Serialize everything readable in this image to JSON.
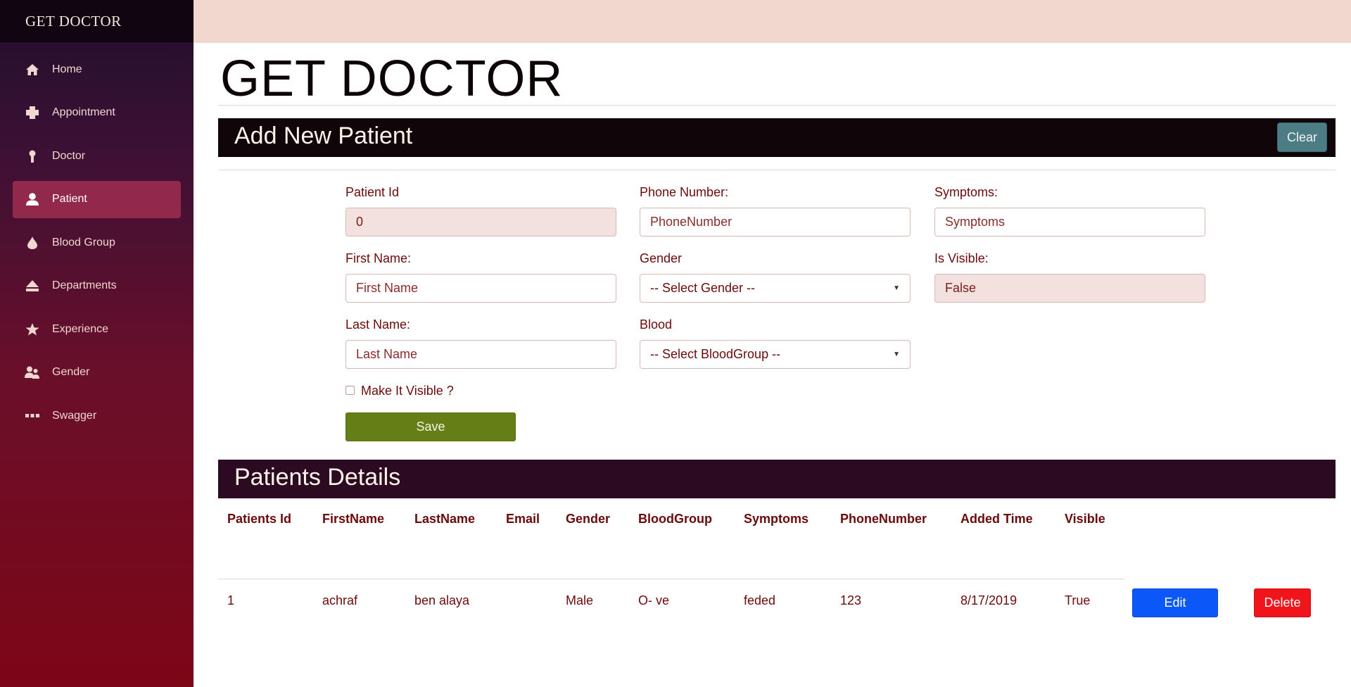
{
  "sidebar": {
    "brand": "GET DOCTOR",
    "items": [
      {
        "label": "Home",
        "icon": "home-icon"
      },
      {
        "label": "Appointment",
        "icon": "plus-icon"
      },
      {
        "label": "Doctor",
        "icon": "doctor-icon"
      },
      {
        "label": "Patient",
        "icon": "user-icon",
        "active": true
      },
      {
        "label": "Blood Group",
        "icon": "drop-icon"
      },
      {
        "label": "Departments",
        "icon": "eject-icon"
      },
      {
        "label": "Experience",
        "icon": "star-icon"
      },
      {
        "label": "Gender",
        "icon": "users-icon"
      },
      {
        "label": "Swagger",
        "icon": "ellipsis-icon"
      }
    ]
  },
  "header": {
    "title": "GET DOCTOR"
  },
  "add_section": {
    "title": "Add New Patient",
    "clear_label": "Clear"
  },
  "form": {
    "patient_id": {
      "label": "Patient Id",
      "value": "0"
    },
    "phone": {
      "label": "Phone Number:",
      "placeholder": "PhoneNumber"
    },
    "symptoms": {
      "label": "Symptoms:",
      "placeholder": "Symptoms"
    },
    "first_name": {
      "label": "First Name:",
      "placeholder": "First Name"
    },
    "gender": {
      "label": "Gender",
      "selected": "-- Select Gender --"
    },
    "is_visible": {
      "label": "Is Visible:",
      "value": "False"
    },
    "last_name": {
      "label": "Last Name:",
      "placeholder": "Last Name"
    },
    "blood": {
      "label": "Blood",
      "selected": "-- Select BloodGroup --"
    },
    "make_visible": {
      "label": "Make It Visible ?",
      "checked": false
    },
    "save_label": "Save"
  },
  "details": {
    "title": "Patients Details",
    "columns": [
      "Patients Id",
      "FirstName",
      "LastName",
      "Email",
      "Gender",
      "BloodGroup",
      "Symptoms",
      "PhoneNumber",
      "Added Time",
      "Visible"
    ],
    "rows": [
      {
        "id": "1",
        "first_name": "achraf",
        "last_name": "ben alaya",
        "email": "",
        "gender": "Male",
        "blood_group": "O- ve",
        "symptoms": "feded",
        "phone": "123",
        "added_time": "8/17/2019",
        "visible": "True",
        "edit_label": "Edit",
        "delete_label": "Delete"
      }
    ]
  },
  "colors": {
    "accent_active": "#92284b",
    "save": "#657f16",
    "edit": "#0b57f7",
    "delete": "#ef151a",
    "clear": "#4d7d84",
    "topbar": "#f2d7cf"
  }
}
